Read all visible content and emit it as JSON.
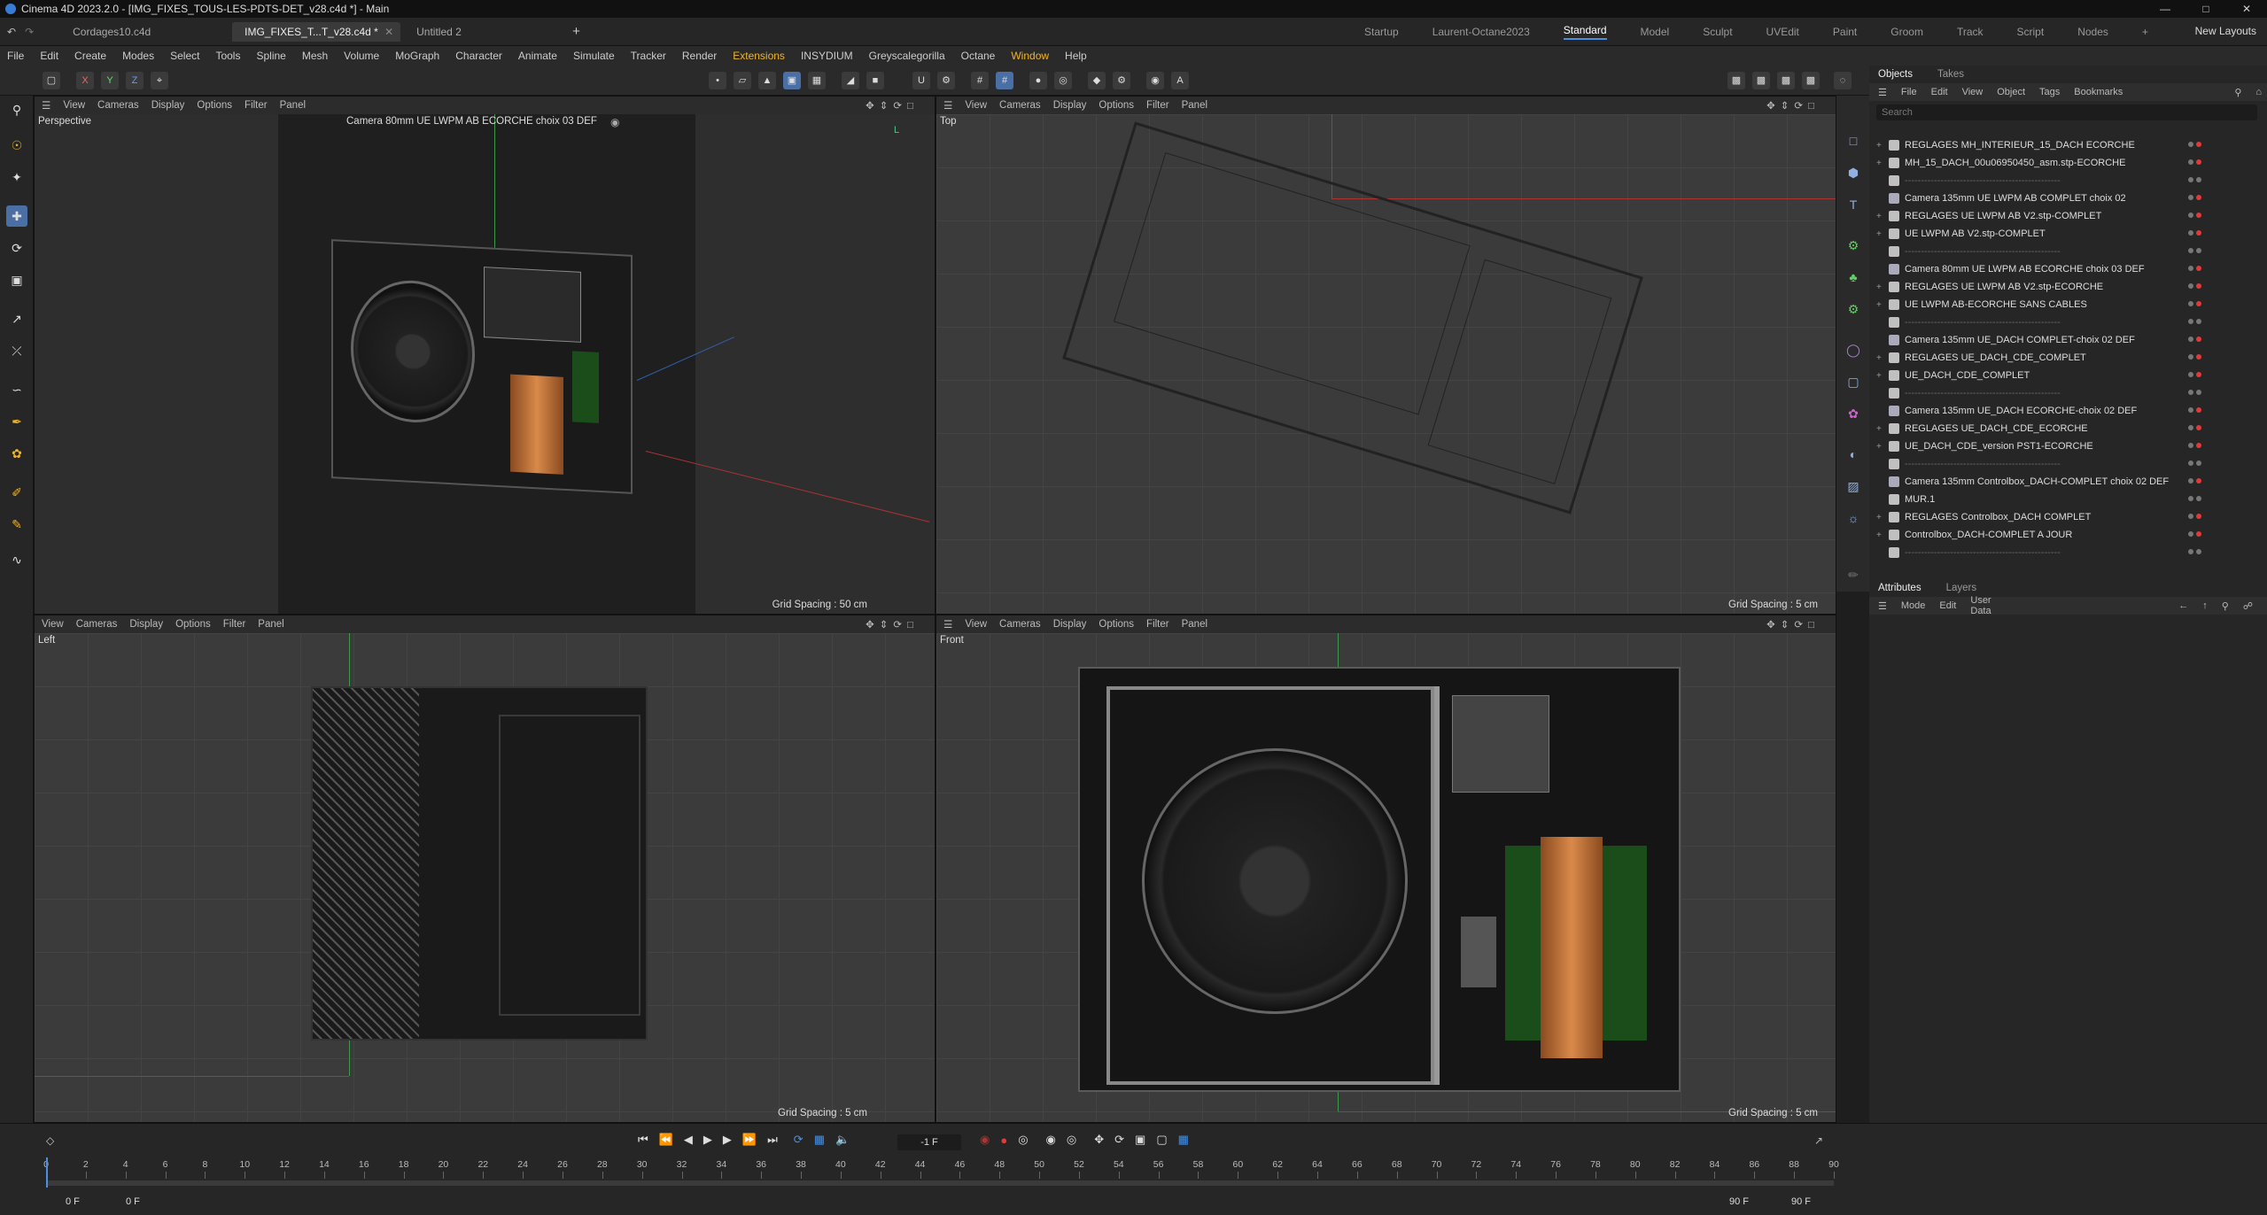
{
  "title": "Cinema 4D 2023.2.0 - [IMG_FIXES_TOUS-LES-PDTS-DET_v28.c4d *] - Main",
  "tabs": [
    {
      "label": "Cordages10.c4d"
    },
    {
      "label": "IMG_FIXES_T...T_v28.c4d *"
    },
    {
      "label": "Untitled 2"
    }
  ],
  "layouts": [
    "Startup",
    "Laurent-Octane2023",
    "Standard",
    "Model",
    "Sculpt",
    "UVEdit",
    "Paint",
    "Groom",
    "Track",
    "Script",
    "Nodes"
  ],
  "new_layouts": "New Layouts",
  "menu": [
    "File",
    "Edit",
    "Create",
    "Modes",
    "Select",
    "Tools",
    "Spline",
    "Mesh",
    "Volume",
    "MoGraph",
    "Character",
    "Animate",
    "Simulate",
    "Tracker",
    "Render",
    "Extensions",
    "INSYDIUM",
    "Greyscalegorilla",
    "Octane",
    "Window",
    "Help"
  ],
  "toolbar_axes": [
    "X",
    "Y",
    "Z"
  ],
  "viewport_menu": [
    "View",
    "Cameras",
    "Display",
    "Options",
    "Filter",
    "Panel"
  ],
  "viewports": {
    "perspective": {
      "name": "Perspective",
      "camera": "Camera 80mm UE LWPM AB ECORCHE choix 03 DEF",
      "grid": "Grid Spacing : 50 cm"
    },
    "top": {
      "name": "Top",
      "grid": "Grid Spacing : 5 cm"
    },
    "left": {
      "name": "Left",
      "grid": "Grid Spacing : 5 cm"
    },
    "front": {
      "name": "Front",
      "grid": "Grid Spacing : 5 cm"
    }
  },
  "objects_panel": {
    "tabs": [
      "Objects",
      "Takes"
    ],
    "menu": [
      "File",
      "Edit",
      "View",
      "Object",
      "Tags",
      "Bookmarks"
    ],
    "search_placeholder": "Search",
    "items": [
      {
        "label": "REGLAGES MH_INTERIEUR_15_DACH ECORCHE",
        "type": "null"
      },
      {
        "label": "MH_15_DACH_00u06950450_asm.stp-ECORCHE",
        "type": "null"
      },
      {
        "label": "------------------------------------------------",
        "type": "sep"
      },
      {
        "label": "Camera 135mm UE LWPM AB COMPLET choix 02",
        "type": "cam"
      },
      {
        "label": "REGLAGES UE LWPM AB V2.stp-COMPLET",
        "type": "null"
      },
      {
        "label": "UE LWPM AB V2.stp-COMPLET",
        "type": "null"
      },
      {
        "label": "------------------------------------------------",
        "type": "sep"
      },
      {
        "label": "Camera 80mm UE LWPM AB ECORCHE choix 03 DEF",
        "type": "cam"
      },
      {
        "label": "REGLAGES UE LWPM AB V2.stp-ECORCHE",
        "type": "null"
      },
      {
        "label": "UE LWPM AB-ECORCHE SANS CABLES",
        "type": "null"
      },
      {
        "label": "------------------------------------------------",
        "type": "sep"
      },
      {
        "label": "Camera 135mm UE_DACH COMPLET-choix 02 DEF",
        "type": "cam"
      },
      {
        "label": "REGLAGES UE_DACH_CDE_COMPLET",
        "type": "null"
      },
      {
        "label": "UE_DACH_CDE_COMPLET",
        "type": "null"
      },
      {
        "label": "------------------------------------------------",
        "type": "sep"
      },
      {
        "label": "Camera 135mm UE_DACH ECORCHE-choix 02 DEF",
        "type": "cam"
      },
      {
        "label": "REGLAGES  UE_DACH_CDE_ECORCHE",
        "type": "null"
      },
      {
        "label": "UE_DACH_CDE_version PST1-ECORCHE",
        "type": "null"
      },
      {
        "label": "------------------------------------------------",
        "type": "sep"
      },
      {
        "label": "Camera 135mm Controlbox_DACH-COMPLET choix 02 DEF",
        "type": "cam"
      },
      {
        "label": "MUR.1",
        "type": "obj"
      },
      {
        "label": "REGLAGES  Controlbox_DACH COMPLET",
        "type": "null"
      },
      {
        "label": "Controlbox_DACH-COMPLET A JOUR",
        "type": "null"
      },
      {
        "label": "------------------------------------------------",
        "type": "sep"
      }
    ]
  },
  "attributes_panel": {
    "tabs": [
      "Attributes",
      "Layers"
    ],
    "menu": [
      "Mode",
      "Edit",
      "User Data"
    ]
  },
  "timeline": {
    "current_frame": "-1 F",
    "ticks": [
      "0",
      "2",
      "4",
      "6",
      "8",
      "10",
      "12",
      "14",
      "16",
      "18",
      "20",
      "22",
      "24",
      "26",
      "28",
      "30",
      "32",
      "34",
      "36",
      "38",
      "40",
      "42",
      "44",
      "46",
      "48",
      "50",
      "52",
      "54",
      "56",
      "58",
      "60",
      "62",
      "64",
      "66",
      "68",
      "70",
      "72",
      "74",
      "76",
      "78",
      "80",
      "82",
      "84",
      "86",
      "88",
      "90"
    ],
    "start_left": "0 F",
    "start_right": "0 F",
    "end_left": "90 F",
    "end_right": "90 F"
  },
  "colors": {
    "accent": "#4a90e2",
    "record": "#e03a3a",
    "highlight_menu": "#f0b429"
  }
}
